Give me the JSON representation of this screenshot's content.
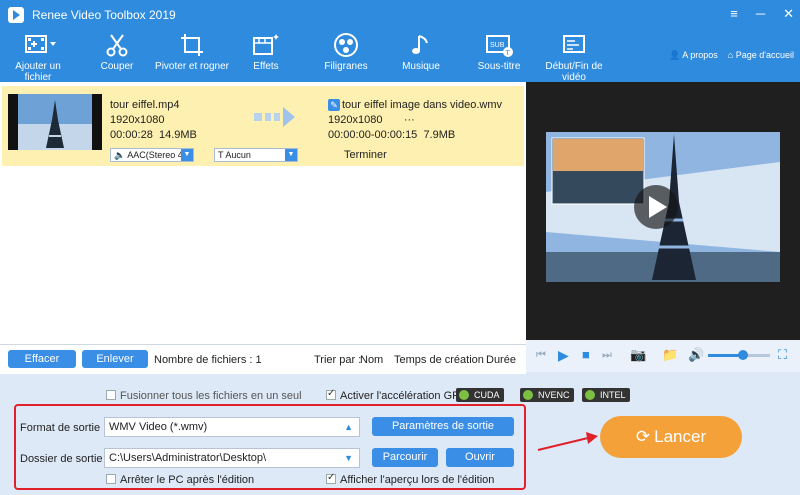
{
  "window": {
    "title": "Renee Video Toolbox 2019",
    "min": "─",
    "max": "☐",
    "close": "✕",
    "menu": "≡"
  },
  "toolbar": {
    "items": [
      {
        "label": "Ajouter un fichier",
        "icon": "add-video-icon"
      },
      {
        "label": "Couper",
        "icon": "scissors-icon"
      },
      {
        "label": "Pivoter et rogner",
        "icon": "rotate-crop-icon"
      },
      {
        "label": "Effets",
        "icon": "effects-icon"
      },
      {
        "label": "Filigranes",
        "icon": "watermark-icon"
      },
      {
        "label": "Musique",
        "icon": "music-icon"
      },
      {
        "label": "Sous-titre",
        "icon": "subtitle-icon"
      },
      {
        "label": "Début/Fin de vidéo",
        "icon": "intro-outro-icon"
      }
    ],
    "about": "A propos",
    "home": "Page d'accueil"
  },
  "file": {
    "src_name": "tour eiffel.mp4",
    "src_res": "1920x1080",
    "src_dur": "00:00:28",
    "src_size": "14.9MB",
    "out_name": "tour eiffel image dans video.wmv",
    "out_res": "1920x1080",
    "out_more": "···",
    "out_range": "00:00:00-00:00:15",
    "out_size": "7.9MB",
    "audio": "AAC(Stereo 4",
    "subtitle": "Aucun",
    "status": "Terminer"
  },
  "listbar": {
    "clear": "Effacer",
    "remove": "Enlever",
    "count_label": "Nombre de fichiers : 1",
    "sort_label": "Trier par :",
    "sort_name": "Nom",
    "sort_time": "Temps de création",
    "sort_dur": "Durée"
  },
  "options": {
    "merge": "Fusionner tous les fichiers en un seul",
    "gpu": "Activer l'accélération GPU",
    "cuda": "CUDA",
    "nvenc": "NVENC",
    "intel": "INTEL",
    "format_label": "Format de sortie :",
    "format_value": "WMV Video (*.wmv)",
    "params": "Paramètres de sortie",
    "folder_label": "Dossier de sortie :",
    "folder_value": "C:\\Users\\Administrator\\Desktop\\",
    "browse": "Parcourir",
    "open": "Ouvrir",
    "shutdown": "Arrêter le PC après l'édition",
    "preview": "Afficher l'aperçu lors de l'édition",
    "launch": "Lancer"
  },
  "colors": {
    "accent": "#2f8bde",
    "highlight": "#fdf0b0",
    "launch": "#f5a13a",
    "red": "#e0212a"
  }
}
